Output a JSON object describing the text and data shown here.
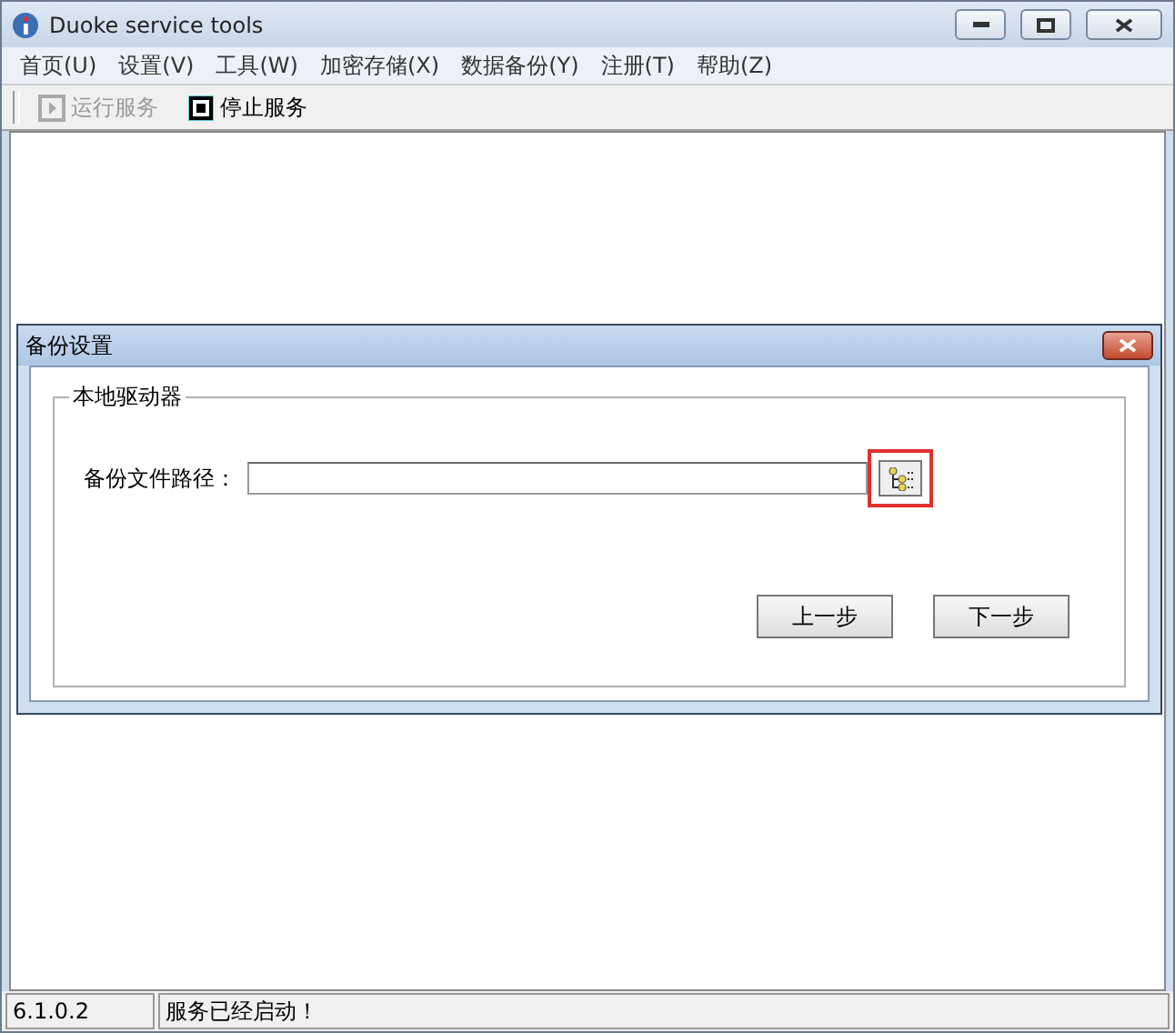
{
  "window": {
    "title": "Duoke service tools"
  },
  "menu": [
    "首页(U)",
    "设置(V)",
    "工具(W)",
    "加密存储(X)",
    "数据备份(Y)",
    "注册(T)",
    "帮助(Z)"
  ],
  "toolbar": [
    {
      "label": "运行服务",
      "disabled": true
    },
    {
      "label": "停止服务",
      "disabled": false
    }
  ],
  "dialog": {
    "title": "备份设置",
    "group": "本地驱动器",
    "field_label": "备份文件路径：",
    "highlighted": true,
    "buttons": [
      "上一步",
      "下一步"
    ]
  },
  "status_bar": [
    "6.1.0.2",
    "服务已经启动！"
  ]
}
